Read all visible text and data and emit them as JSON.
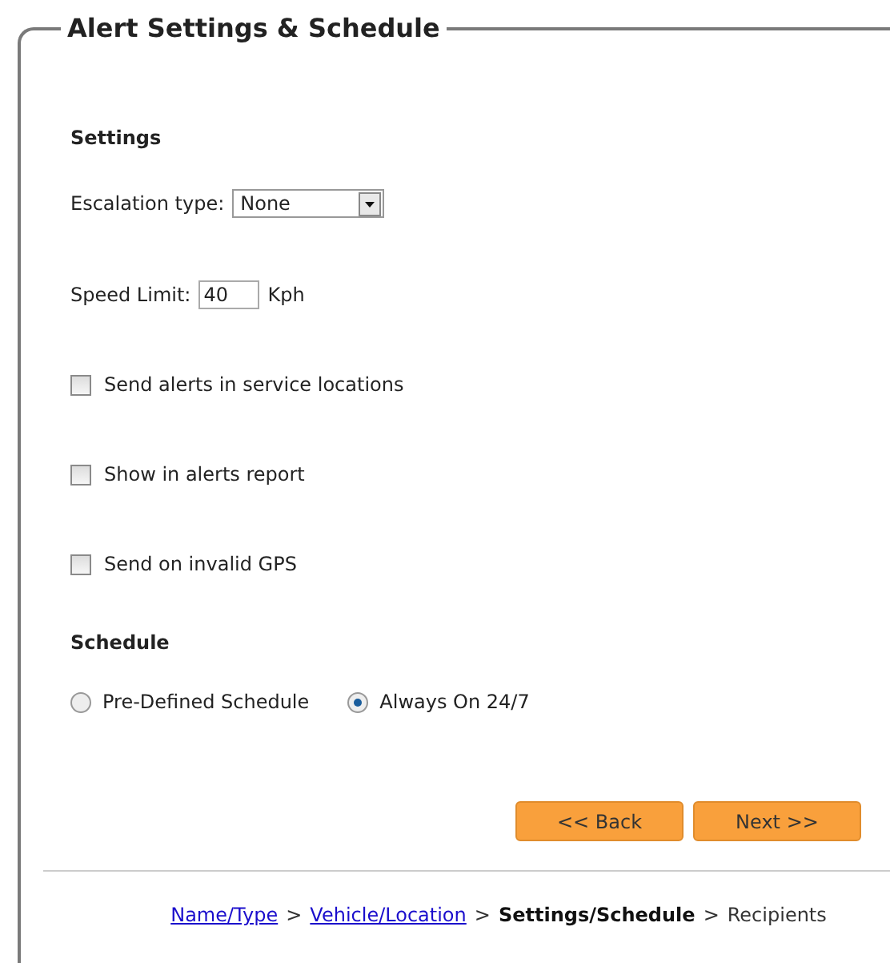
{
  "panel": {
    "title": "Alert Settings & Schedule"
  },
  "settings": {
    "heading": "Settings",
    "escalation": {
      "label": "Escalation type:",
      "value": "None"
    },
    "speed_limit": {
      "label": "Speed Limit:",
      "value": "40",
      "unit": "Kph"
    },
    "options": [
      {
        "label": "Send alerts in service locations",
        "checked": false
      },
      {
        "label": "Show in alerts report",
        "checked": false
      },
      {
        "label": "Send on invalid GPS",
        "checked": false
      }
    ]
  },
  "schedule": {
    "heading": "Schedule",
    "options": [
      {
        "label": "Pre-Defined Schedule",
        "selected": false
      },
      {
        "label": "Always On 24/7",
        "selected": true
      }
    ]
  },
  "buttons": [
    "<< Back",
    "Next >>"
  ],
  "breadcrumb": [
    {
      "kind": "link",
      "text": "Name/Type"
    },
    {
      "kind": "separator",
      "text": ">"
    },
    {
      "kind": "link",
      "text": "Vehicle/Location"
    },
    {
      "kind": "separator",
      "text": ">"
    },
    {
      "kind": "current",
      "text": "Settings/Schedule"
    },
    {
      "kind": "separator",
      "text": ">"
    },
    {
      "kind": "plain",
      "text": "Recipients"
    }
  ]
}
